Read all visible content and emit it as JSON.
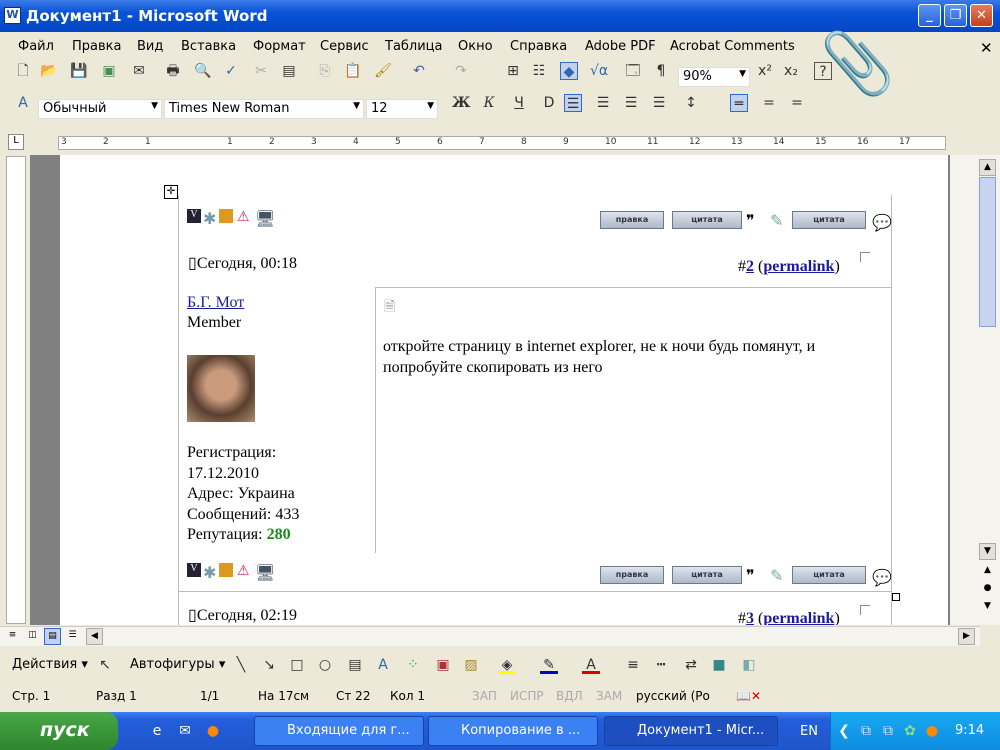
{
  "window": {
    "title": "Документ1 - Microsoft Word",
    "app_icon": "W"
  },
  "menu": [
    "Файл",
    "Правка",
    "Вид",
    "Вставка",
    "Формат",
    "Сервис",
    "Таблица",
    "Окно",
    "Справка",
    "Adobe PDF",
    "Acrobat Comments"
  ],
  "toolbar": {
    "zoom": "90%",
    "style": "Обычный",
    "font": "Times New Roman",
    "size": "12",
    "bold": "Ж",
    "italic": "К",
    "underline": "Ч"
  },
  "ruler": {
    "ticks": [
      "3",
      "2",
      "1",
      "1",
      "2",
      "3",
      "4",
      "5",
      "6",
      "7",
      "8",
      "9",
      "10",
      "11",
      "12",
      "13",
      "14",
      "15",
      "16",
      "17"
    ]
  },
  "post1": {
    "date": "Сегодня, 00:18",
    "number_prefix": "#",
    "number": "2",
    "permalink": "permalink",
    "author": "Б.Г. Мот",
    "role": "Member",
    "reg_label": "Регистрация:",
    "reg_date": "17.12.2010",
    "address": "Адрес: Украина",
    "messages": "Сообщений: 433",
    "rep_label": "Репутация: ",
    "rep_value": "280",
    "text": "откройте страницу в internet explorer, не к ночи будь помянут, и попробуйте скопировать из него",
    "buttons": [
      "правка",
      "цитата",
      "цитата"
    ]
  },
  "post2": {
    "date": "Сегодня, 02:19",
    "number_prefix": "#",
    "number": "3",
    "permalink": "permalink"
  },
  "drawing": {
    "actions": "Действия",
    "autoshapes": "Автофигуры"
  },
  "status": {
    "page": "Стр. 1",
    "section": "Разд 1",
    "pages": "1/1",
    "at": "На 17см",
    "line": "Ст 22",
    "col": "Кол 1",
    "rec": "ЗАП",
    "trk": "ИСПР",
    "ext": "ВДЛ",
    "ovr": "ЗАМ",
    "lang": "русский (Ро"
  },
  "taskbar": {
    "start": "пуск",
    "tasks": [
      "Входящие для г...",
      "Копирование в ...",
      "Документ1 - Micr..."
    ],
    "lang": "EN",
    "clock": "9:14"
  },
  "colors": {
    "accent": "#0a52d6",
    "reputation": "#1a8a1a",
    "link": "#1c1c9b"
  }
}
